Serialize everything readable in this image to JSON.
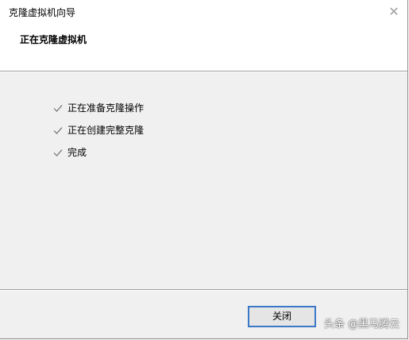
{
  "window": {
    "title": "克隆虚拟机向导",
    "close_glyph": "✕"
  },
  "header": {
    "title": "正在克隆虚拟机"
  },
  "steps": [
    {
      "label": "正在准备克隆操作",
      "status": "done"
    },
    {
      "label": "正在创建完整克隆",
      "status": "done"
    },
    {
      "label": "完成",
      "status": "done"
    }
  ],
  "footer": {
    "close_label": "关闭"
  },
  "watermark": {
    "text": "头条 @黑马腾云"
  },
  "colors": {
    "check": "#6e6e6e",
    "button_focus_border": "#3c78c8",
    "dialog_bg": "#f0f0f0"
  }
}
